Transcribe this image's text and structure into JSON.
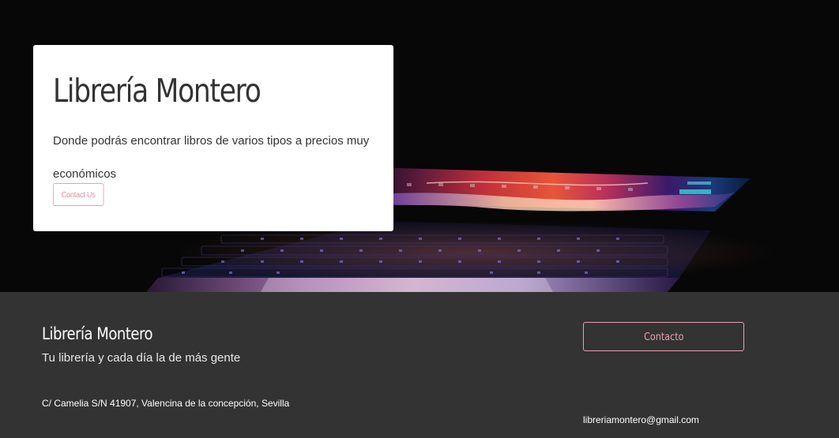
{
  "hero": {
    "title": "Librería Montero",
    "description": "Donde podrás encontrar libros de varios tipos a precios muy económicos",
    "button_label": "Contact Us",
    "accent_color": "#e8a0b2"
  },
  "footer": {
    "title": "Librería Montero",
    "tagline": "Tu librería y cada día la de más gente",
    "address": "C/ Camelia S/N 41907, Valencina de la concepción, Sevilla",
    "contact_button_label": "Contacto",
    "email": "libreriamontero@gmail.com",
    "background_color": "#333333"
  }
}
